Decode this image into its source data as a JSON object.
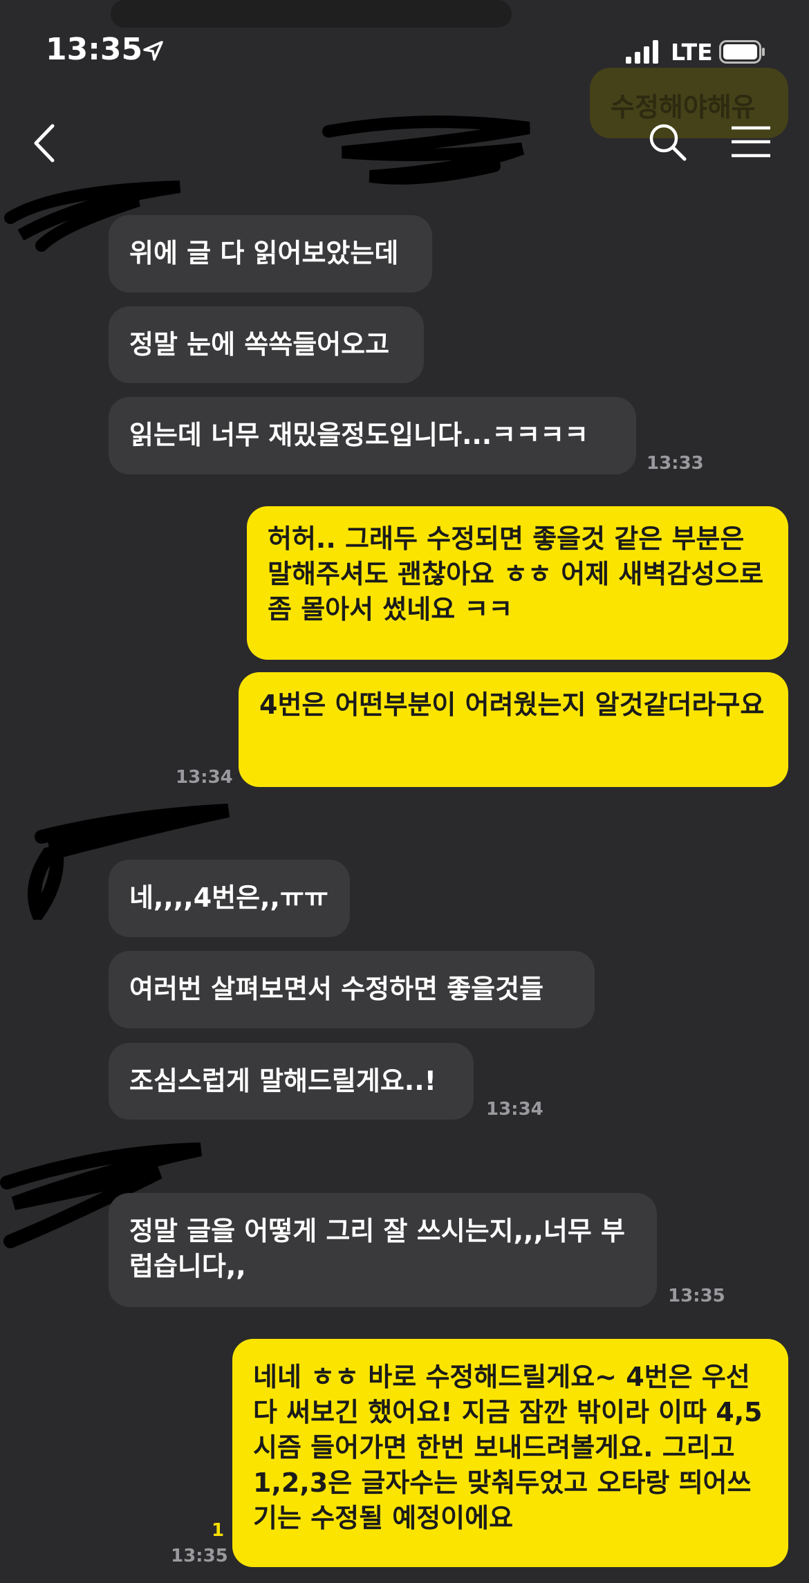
{
  "status_bar": {
    "time": "13:35",
    "network": "LTE"
  },
  "background_preview": {
    "text": "수정해야해유"
  },
  "messages": [
    {
      "text": "위에 글 다 읽어보았는데"
    },
    {
      "text": "정말 눈에 쏙쏙들어오고"
    },
    {
      "text": "읽는데 너무 재밌을정도입니다...ㅋㅋㅋㅋ",
      "time": "13:33"
    },
    {
      "text": "허허.. 그래두 수정되면 좋을것 같은 부분은 말해주셔도 괜찮아요 ㅎㅎ 어제 새벽감성으로 좀 몰아서 썼네요 ㅋㅋ"
    },
    {
      "text": "4번은 어떤부분이 어려웠는지 알것같더라구요",
      "time": "13:34"
    },
    {
      "text": "네,,,,4번은,,ㅠㅠ"
    },
    {
      "text": "여러번 살펴보면서 수정하면 좋을것들"
    },
    {
      "text": "조심스럽게 말해드릴게요..!",
      "time": "13:34"
    },
    {
      "text": "정말 글을 어떻게 그리 잘 쓰시는지,,,너무 부럽습니다,,",
      "time": "13:35"
    },
    {
      "text": "네네 ㅎㅎ 바로 수정해드릴게요~ 4번은 우선 다 써보긴 했어요! 지금 잠깐 밖이라 이따 4,5시즘 들어가면 한번 보내드려볼게요. 그리고 1,2,3은 글자수는 맞춰두었고 오타랑 띄어쓰기는 수정될 예정이에요",
      "time": "13:35",
      "unread": "1"
    }
  ]
}
